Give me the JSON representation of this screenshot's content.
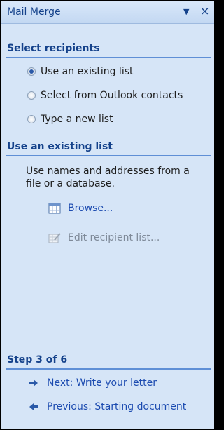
{
  "panel": {
    "title": "Mail Merge",
    "menu_icon": "triangle-down-icon",
    "close_icon": "close-icon"
  },
  "select_recipients": {
    "heading": "Select recipients",
    "options": [
      {
        "label": "Use an existing list",
        "selected": true
      },
      {
        "label": "Select from Outlook contacts",
        "selected": false
      },
      {
        "label": "Type a new list",
        "selected": false
      }
    ]
  },
  "existing_list": {
    "heading": "Use an existing list",
    "description_line1": "Use names and addresses from a",
    "description_line2": "file or a database.",
    "browse_label": "Browse...",
    "edit_label": "Edit recipient list..."
  },
  "step": {
    "heading": "Step 3 of 6",
    "next_label": "Next: Write your letter",
    "previous_label": "Previous: Starting document"
  },
  "colors": {
    "pane_bg": "#d6e5f7",
    "heading": "#15428b",
    "link": "#1c4bb0",
    "disabled": "#7f8a99"
  }
}
